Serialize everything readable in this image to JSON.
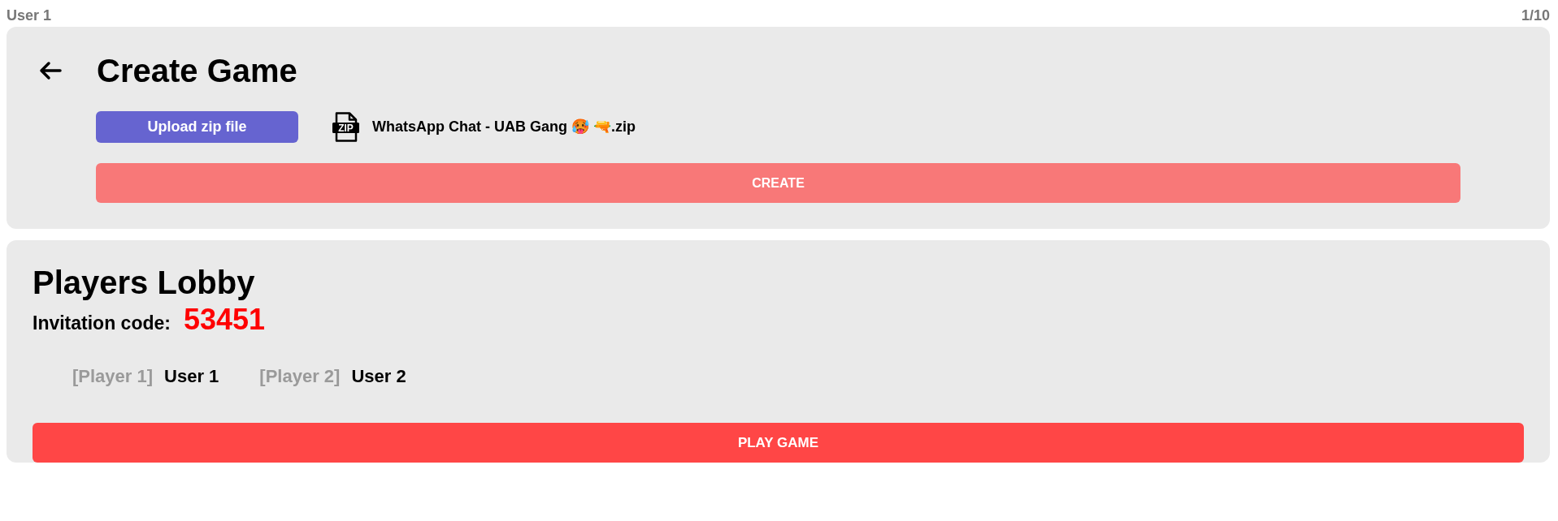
{
  "header": {
    "user": "User 1",
    "progress": "1/10"
  },
  "create_game": {
    "title": "Create Game",
    "upload_button": "Upload zip file",
    "file": {
      "badge": "ZIP",
      "name": "WhatsApp Chat - UAB Gang 🥵 🔫.zip"
    },
    "create_button": {
      "label": "CREATE",
      "disabled": true
    }
  },
  "lobby": {
    "title": "Players Lobby",
    "invitation_label": "Invitation code:",
    "invitation_code": "53451",
    "players": [
      {
        "tag": "[Player 1]",
        "name": "User 1"
      },
      {
        "tag": "[Player 2]",
        "name": "User 2"
      }
    ],
    "play_button": {
      "label": "PLAY GAME"
    }
  }
}
